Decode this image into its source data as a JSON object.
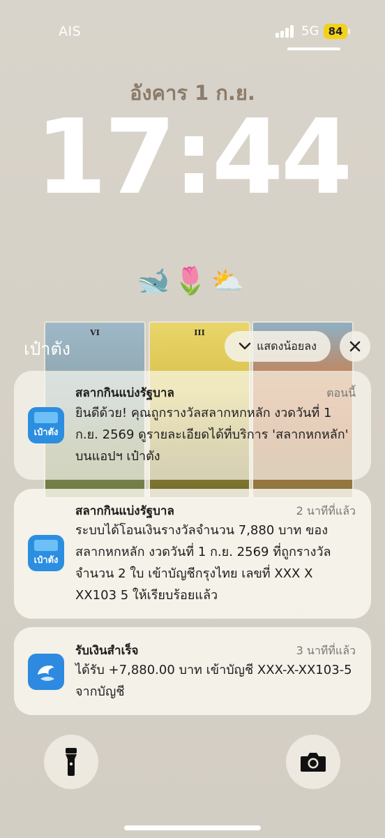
{
  "status_bar": {
    "carrier": "AIS",
    "network": "5G",
    "battery": "84",
    "signal_icon": "signal-bars-icon"
  },
  "lock_screen": {
    "date": "อังคาร 1 ก.ย.",
    "time": "17:44",
    "widgets": "🐋🌷⛅"
  },
  "notification_group": {
    "app_name": "เป๋าตัง",
    "show_less_label": "แสดงน้อยลง",
    "close_icon": "close-icon"
  },
  "notifications": [
    {
      "app_icon": "pao-tang-app-icon",
      "icon_label": "เป๋าตัง",
      "title": "สลากกินแบ่งรัฐบาล",
      "time": "ตอนนี้",
      "body": "ยินดีด้วย! คุณถูกรางวัลสลากหกหลัก งวดวันที่ 1 ก.ย. 2569 ดูรายละเอียดได้ที่บริการ 'สลากหกหลัก' บนแอปฯ เป๋าตัง"
    },
    {
      "app_icon": "pao-tang-app-icon",
      "icon_label": "เป๋าตัง",
      "title": "สลากกินแบ่งรัฐบาล",
      "time": "2 นาทีที่แล้ว",
      "body": "ระบบได้โอนเงินรางวัลจำนวน 7,880 บาท ของสลากหกหลัก งวดวันที่ 1 ก.ย. 2569 ที่ถูกรางวัลจำนวน 2 ใบ เข้าบัญชีกรุงไทย เลขที่ XXX X XX103 5 ให้เรียบร้อยแล้ว"
    },
    {
      "app_icon": "krungthai-bank-icon",
      "title": "รับเงินสำเร็จ",
      "time": "3 นาทีที่แล้ว",
      "body": "ได้รับ +7,880.00 บาท เข้าบัญชี XXX-X-XX103-5 จากบัญชี"
    }
  ],
  "tarot_cards": [
    "VI",
    "III",
    ""
  ],
  "bottom_controls": {
    "flashlight_icon": "flashlight-icon",
    "camera_icon": "camera-icon"
  }
}
